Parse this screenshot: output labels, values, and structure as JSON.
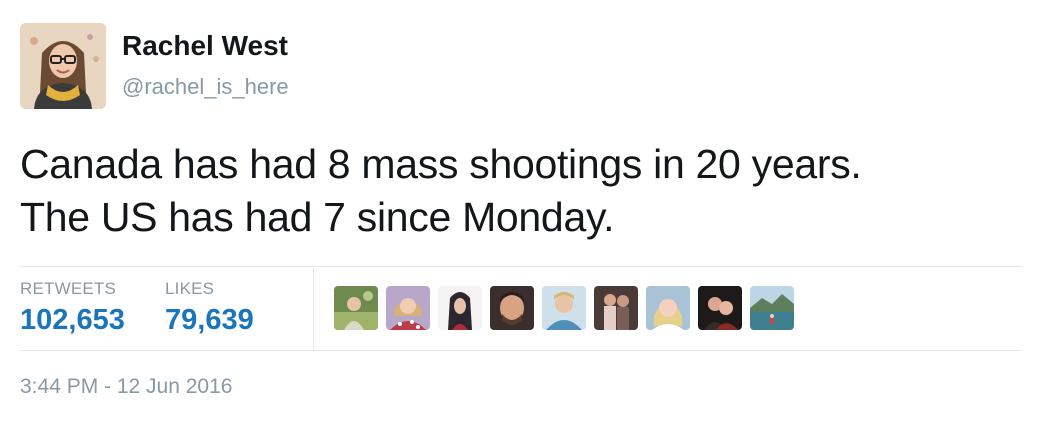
{
  "user": {
    "name": "Rachel West",
    "handle": "@rachel_is_here",
    "avatar_icon": "profile-photo"
  },
  "tweet": {
    "lines": [
      "Canada has had 8 mass shootings in 20 years.",
      "The US has had 7 since Monday."
    ]
  },
  "stats": {
    "retweets_label": "RETWEETS",
    "retweets_value": "102,653",
    "likes_label": "LIKES",
    "likes_value": "79,639"
  },
  "likers": [
    {
      "icon": "liker-avatar-1",
      "color": "#6f8a4e"
    },
    {
      "icon": "liker-avatar-2",
      "color": "#c98a7a"
    },
    {
      "icon": "liker-avatar-3",
      "color": "#2b2630"
    },
    {
      "icon": "liker-avatar-4",
      "color": "#7a5a48"
    },
    {
      "icon": "liker-avatar-5",
      "color": "#6aa3c0"
    },
    {
      "icon": "liker-avatar-6",
      "color": "#4a3b38"
    },
    {
      "icon": "liker-avatar-7",
      "color": "#a9c2d6"
    },
    {
      "icon": "liker-avatar-8",
      "color": "#1e1a1a"
    },
    {
      "icon": "liker-avatar-9",
      "color": "#3f7f8f"
    }
  ],
  "timestamp": "3:44 PM - 12 Jun 2016",
  "colors": {
    "text": "#14171a",
    "muted": "#8899a6",
    "accent": "#1b75bb",
    "divider": "#e1e8ed"
  }
}
